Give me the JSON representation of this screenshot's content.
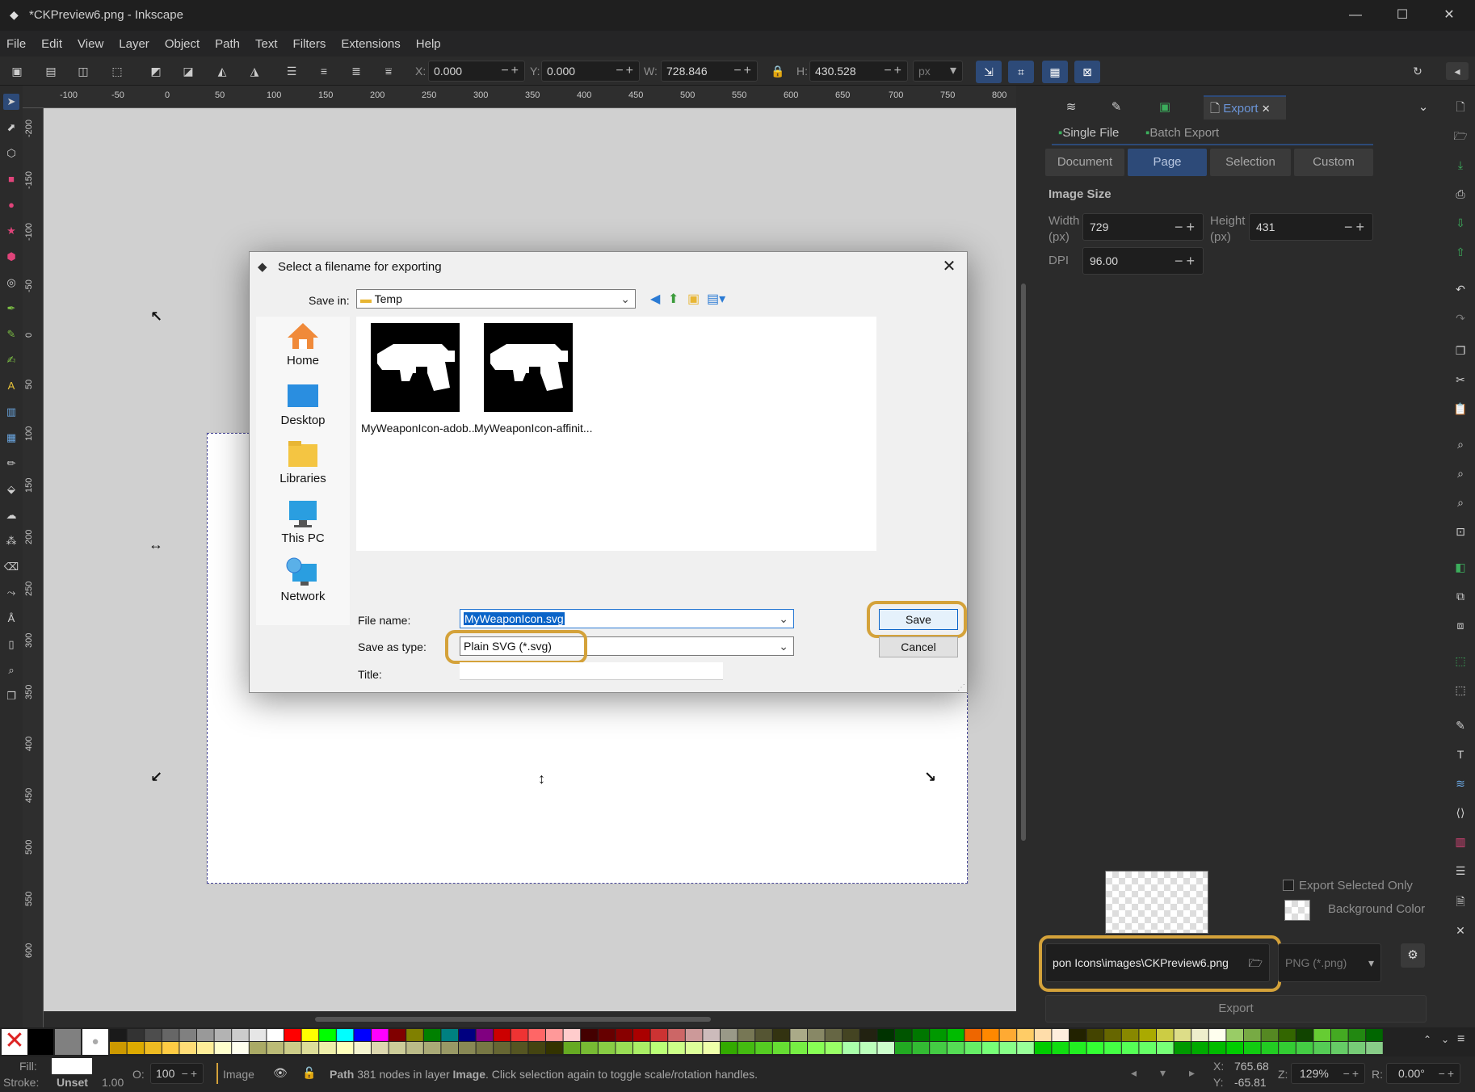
{
  "window": {
    "title": "*CKPreview6.png - Inkscape",
    "minimize": "—",
    "maximize": "☐",
    "close": "✕"
  },
  "menu": [
    "File",
    "Edit",
    "View",
    "Layer",
    "Object",
    "Path",
    "Text",
    "Filters",
    "Extensions",
    "Help"
  ],
  "toolbar": {
    "x_label": "X:",
    "x_value": "0.000",
    "y_label": "Y:",
    "y_value": "0.000",
    "w_label": "W:",
    "w_value": "728.846",
    "h_label": "H:",
    "h_value": "430.528",
    "unit": "px"
  },
  "ruler_top": [
    "-100",
    "-50",
    "0",
    "50",
    "100",
    "150",
    "200",
    "250",
    "300",
    "350",
    "400",
    "450",
    "500",
    "550",
    "600",
    "650",
    "700",
    "750",
    "800"
  ],
  "ruler_left": [
    "-200",
    "-150",
    "-100",
    "-50",
    "0",
    "50",
    "100",
    "150",
    "200",
    "250",
    "300",
    "350",
    "400",
    "450",
    "500",
    "550",
    "600"
  ],
  "dock": {
    "tab_export": "Export",
    "tab_close": "✕",
    "single_file": "Single File",
    "batch_export": "Batch Export",
    "areas": [
      "Document",
      "Page",
      "Selection",
      "Custom"
    ],
    "active_area": "Page",
    "image_size": "Image Size",
    "width_label": "Width\n(px)",
    "width_value": "729",
    "height_label": "Height\n(px)",
    "height_value": "431",
    "dpi_label": "DPI",
    "dpi_value": "96.00",
    "export_selected_only": "Export Selected Only",
    "background_color": "Background Color",
    "filename": "pon Icons\\images\\CKPreview6.png",
    "filetype": "PNG (*.png)",
    "export_button": "Export"
  },
  "dialog": {
    "title": "Select a filename for exporting",
    "save_in_label": "Save in:",
    "save_in_value": "Temp",
    "places": [
      "Home",
      "Desktop",
      "Libraries",
      "This PC",
      "Network"
    ],
    "files": [
      "MyWeaponIcon-adob...",
      "MyWeaponIcon-affinit..."
    ],
    "file_name_label": "File name:",
    "file_name_value": "MyWeaponIcon.svg",
    "save_as_type_label": "Save as type:",
    "save_as_type_value": "Plain SVG (*.svg)",
    "title_label": "Title:",
    "save_button": "Save",
    "cancel_button": "Cancel"
  },
  "status": {
    "fill_label": "Fill:",
    "stroke_label": "Stroke:",
    "stroke_value": "Unset",
    "stroke_width": "1.00",
    "opacity_label": "O:",
    "opacity_value": "100",
    "layer": "Image",
    "message_bold": "Path",
    "message_part1": " 381 nodes in layer ",
    "message_layer": "Image",
    "message_part2": ". Click selection again to toggle scale/rotation handles.",
    "x_label": "X:",
    "x_value": "765.68",
    "y_label": "Y:",
    "y_value": "-65.81",
    "zoom_label": "Z:",
    "zoom_value": "129%",
    "rotate_label": "R:",
    "rotate_value": "0.00°"
  },
  "colors": {
    "accent": "#2d4a78",
    "highlight": "#d4a23a"
  }
}
